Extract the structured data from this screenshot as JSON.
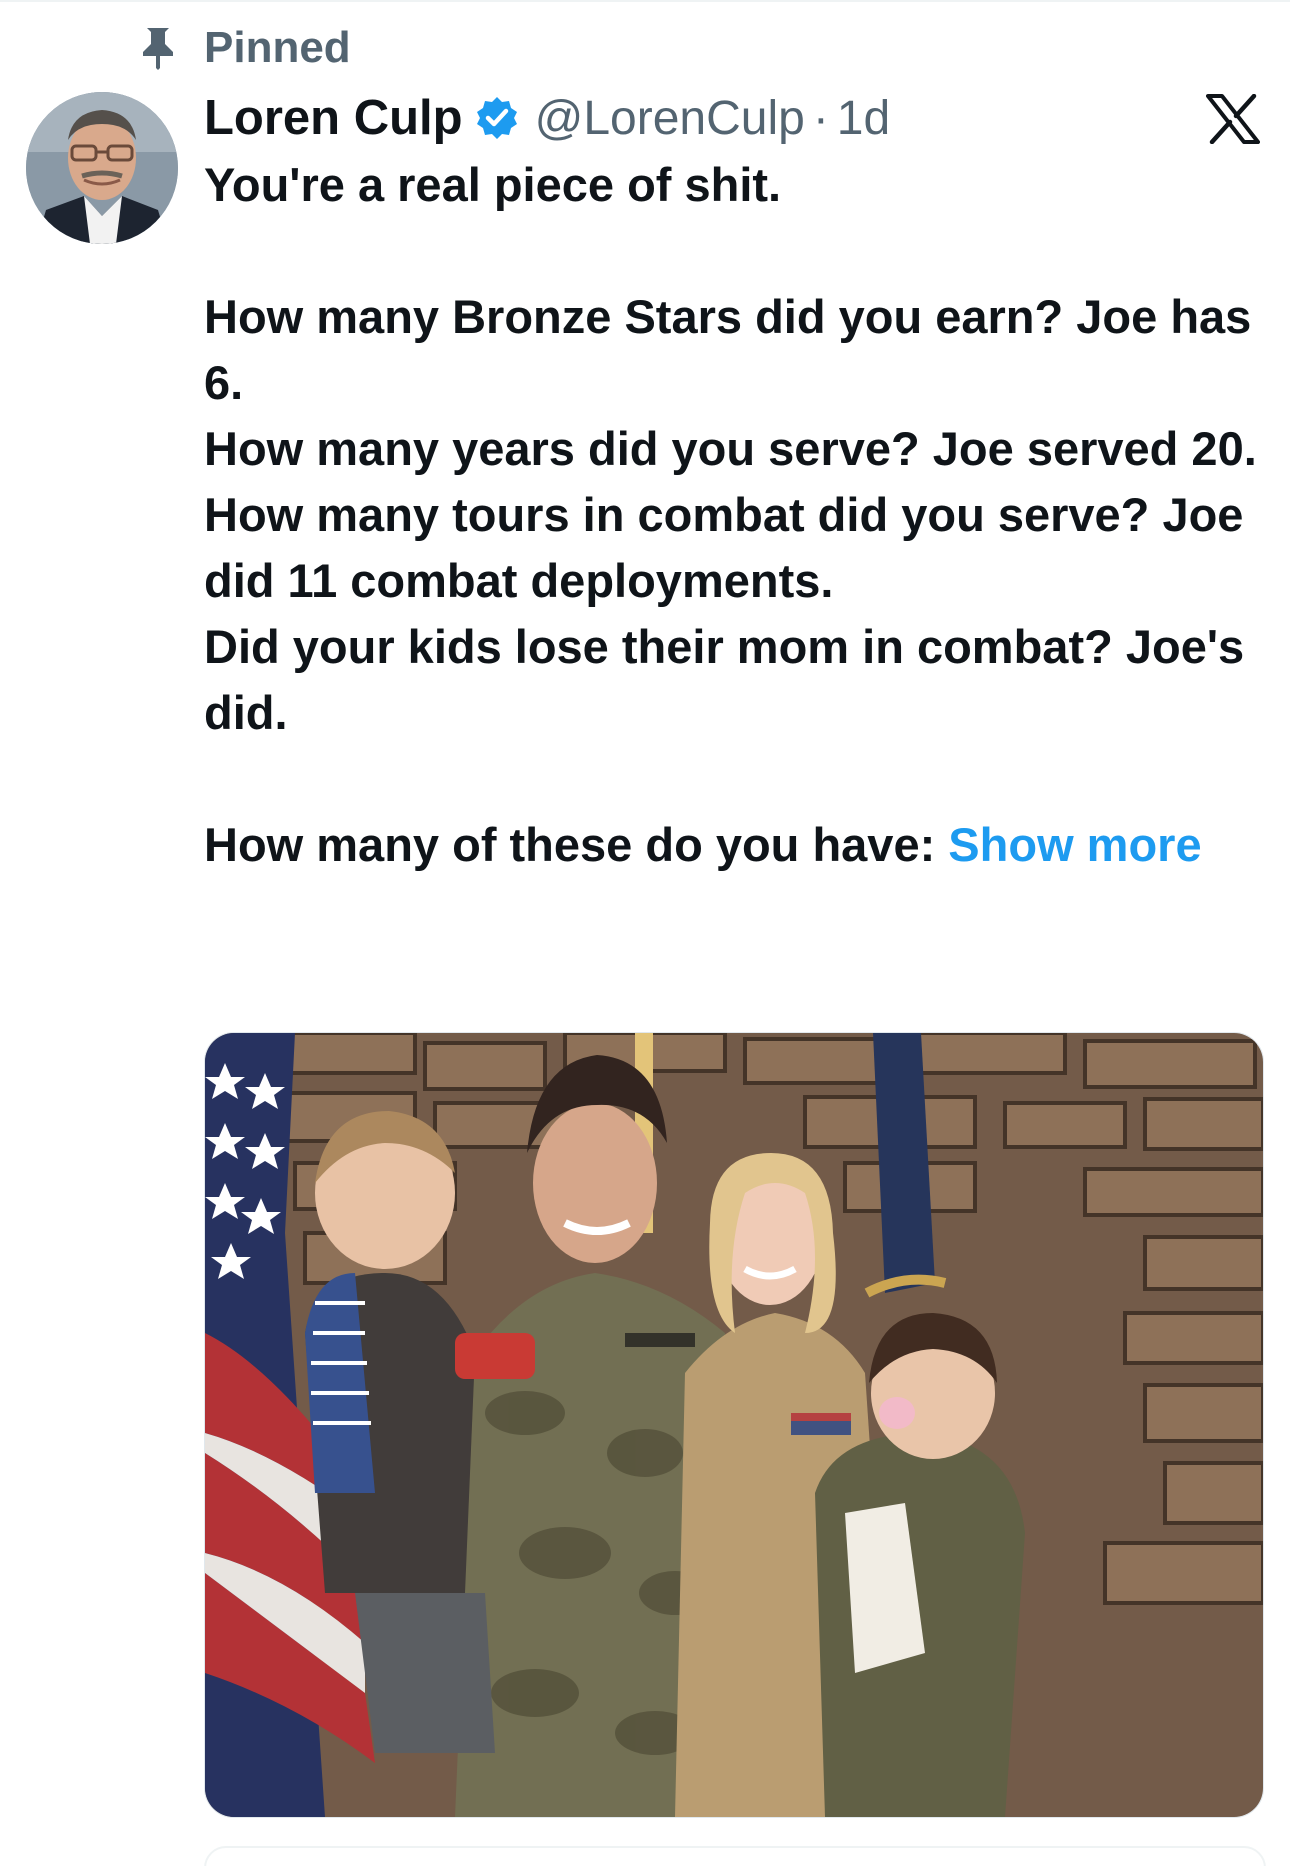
{
  "pinned": {
    "label": "Pinned",
    "icon": "pin-icon"
  },
  "author": {
    "display_name": "Loren Culp",
    "handle": "@LorenCulp",
    "separator": "·",
    "time": "1d",
    "verified_icon": "verified-badge-icon",
    "verified_color": "#1d9bf0"
  },
  "tweet": {
    "lines": [
      "You're a real piece of shit.",
      "",
      "How many Bronze Stars did you earn? Joe has 6.",
      "How many years did you serve? Joe served 20.",
      "How many tours in combat did you serve? Joe did 11 combat deployments.",
      "Did your kids lose their mom in combat? Joe's did.",
      "",
      "How many of these do you have: "
    ],
    "show_more": "Show more"
  },
  "menu": {
    "icon": "close-x-icon"
  },
  "colors": {
    "text": "#0f1419",
    "secondary": "#536471",
    "link": "#1d9bf0"
  }
}
